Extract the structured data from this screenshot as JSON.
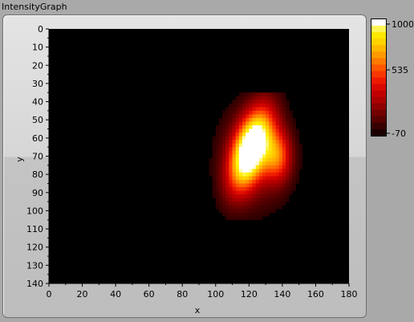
{
  "control": {
    "label": "IntensityGraph"
  },
  "chart_data": {
    "type": "heatmap",
    "xlabel": "x",
    "ylabel": "y",
    "xlim": [
      0,
      180
    ],
    "ylim": [
      0,
      140
    ],
    "y_inverted": true,
    "x_ticks": [
      "0",
      "20",
      "40",
      "60",
      "80",
      "100",
      "120",
      "140",
      "160",
      "180"
    ],
    "y_ticks": [
      "0",
      "10",
      "20",
      "30",
      "40",
      "50",
      "60",
      "70",
      "80",
      "90",
      "100",
      "110",
      "120",
      "130",
      "140"
    ],
    "colorscale": {
      "min": -70,
      "max": 1000,
      "tick_labels": [
        "1000",
        "535",
        "-70"
      ],
      "colors": [
        "#000000",
        "#2a0000",
        "#550000",
        "#800000",
        "#aa0000",
        "#cc0000",
        "#ee1a00",
        "#ff4400",
        "#ff7a00",
        "#ffaa00",
        "#ffd400",
        "#fff200",
        "#ffffff"
      ]
    },
    "background_value": -70,
    "blob": {
      "description_points": [
        {
          "x": 113,
          "y": 45,
          "value": 1000
        },
        {
          "x": 120,
          "y": 60,
          "value": 1000
        },
        {
          "x": 125,
          "y": 80,
          "value": 1000
        },
        {
          "x": 135,
          "y": 70,
          "value": 820
        },
        {
          "x": 140,
          "y": 65,
          "value": 600
        },
        {
          "x": 100,
          "y": 70,
          "value": 250
        },
        {
          "x": 110,
          "y": 95,
          "value": 150
        },
        {
          "x": 150,
          "y": 75,
          "value": 150
        }
      ]
    }
  },
  "colors": {
    "background": "#a9a9a9",
    "frame": "#d6d6d6",
    "plot_background": "#000000"
  }
}
